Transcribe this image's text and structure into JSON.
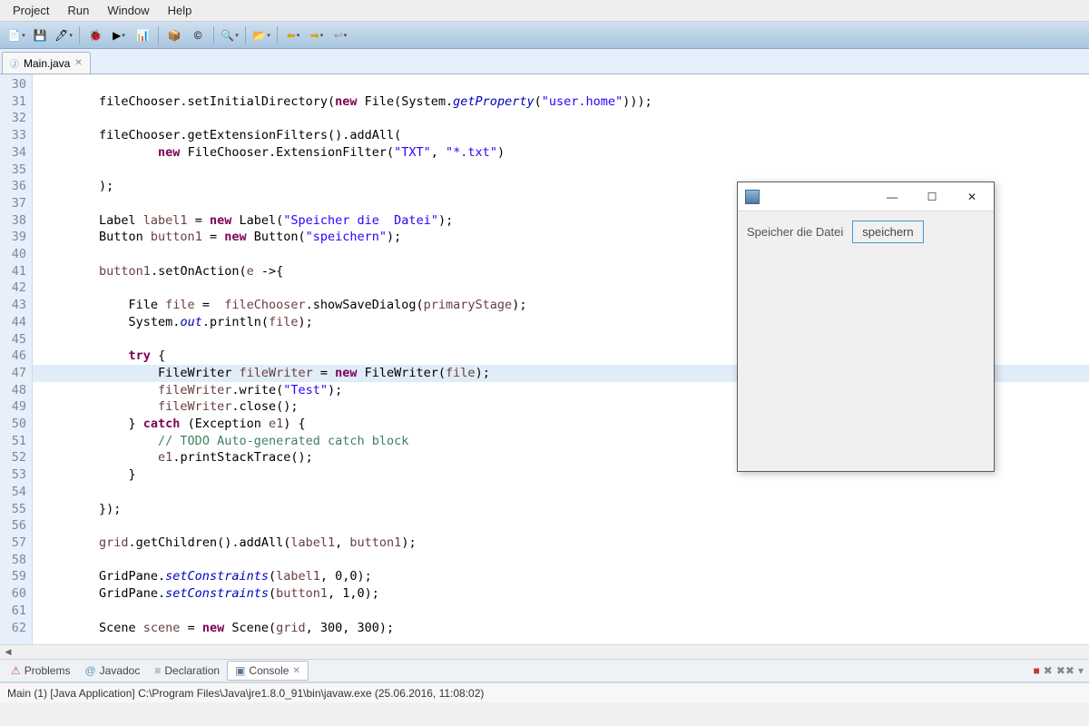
{
  "menu": {
    "items": [
      "Project",
      "Run",
      "Window",
      "Help"
    ]
  },
  "tab": {
    "name": "Main.java"
  },
  "gutter": {
    "start": 30,
    "end": 62
  },
  "highlight_line": 47,
  "code_lines": [
    {
      "n": 30,
      "tokens": []
    },
    {
      "n": 31,
      "tokens": [
        {
          "t": "        fileChooser.setInitialDirectory("
        },
        {
          "t": "new ",
          "c": "kw"
        },
        {
          "t": "File(System."
        },
        {
          "t": "getProperty",
          "c": "fstat"
        },
        {
          "t": "("
        },
        {
          "t": "\"user.home\"",
          "c": "str"
        },
        {
          "t": ")));"
        }
      ]
    },
    {
      "n": 32,
      "tokens": []
    },
    {
      "n": 33,
      "tokens": [
        {
          "t": "        fileChooser.getExtensionFilters().addAll("
        }
      ]
    },
    {
      "n": 34,
      "tokens": [
        {
          "t": "                "
        },
        {
          "t": "new ",
          "c": "kw"
        },
        {
          "t": "FileChooser.ExtensionFilter("
        },
        {
          "t": "\"TXT\"",
          "c": "str"
        },
        {
          "t": ", "
        },
        {
          "t": "\"*.txt\"",
          "c": "str"
        },
        {
          "t": ")"
        }
      ]
    },
    {
      "n": 35,
      "tokens": []
    },
    {
      "n": 36,
      "tokens": [
        {
          "t": "        );"
        }
      ]
    },
    {
      "n": 37,
      "tokens": []
    },
    {
      "n": 38,
      "tokens": [
        {
          "t": "        Label "
        },
        {
          "t": "label1",
          "c": "lvar"
        },
        {
          "t": " = "
        },
        {
          "t": "new ",
          "c": "kw"
        },
        {
          "t": "Label("
        },
        {
          "t": "\"Speicher die  Datei\"",
          "c": "str"
        },
        {
          "t": ");"
        }
      ]
    },
    {
      "n": 39,
      "tokens": [
        {
          "t": "        Button "
        },
        {
          "t": "button1",
          "c": "lvar"
        },
        {
          "t": " = "
        },
        {
          "t": "new ",
          "c": "kw"
        },
        {
          "t": "Button("
        },
        {
          "t": "\"speichern\"",
          "c": "str"
        },
        {
          "t": ");"
        }
      ]
    },
    {
      "n": 40,
      "tokens": []
    },
    {
      "n": 41,
      "tokens": [
        {
          "t": "        "
        },
        {
          "t": "button1",
          "c": "lvar"
        },
        {
          "t": ".setOnAction("
        },
        {
          "t": "e",
          "c": "lvar"
        },
        {
          "t": " ->{"
        }
      ]
    },
    {
      "n": 42,
      "tokens": []
    },
    {
      "n": 43,
      "tokens": [
        {
          "t": "            File "
        },
        {
          "t": "file",
          "c": "lvar"
        },
        {
          "t": " =  "
        },
        {
          "t": "fileChooser",
          "c": "lvar"
        },
        {
          "t": ".showSaveDialog("
        },
        {
          "t": "primaryStage",
          "c": "lvar"
        },
        {
          "t": ");"
        }
      ]
    },
    {
      "n": 44,
      "tokens": [
        {
          "t": "            System."
        },
        {
          "t": "out",
          "c": "fstat"
        },
        {
          "t": ".println("
        },
        {
          "t": "file",
          "c": "lvar"
        },
        {
          "t": ");"
        }
      ]
    },
    {
      "n": 45,
      "tokens": []
    },
    {
      "n": 46,
      "tokens": [
        {
          "t": "            "
        },
        {
          "t": "try",
          "c": "kw"
        },
        {
          "t": " {"
        }
      ]
    },
    {
      "n": 47,
      "tokens": [
        {
          "t": "                FileWriter "
        },
        {
          "t": "fileWriter",
          "c": "lvar"
        },
        {
          "t": " = "
        },
        {
          "t": "new ",
          "c": "kw"
        },
        {
          "t": "FileWriter("
        },
        {
          "t": "file",
          "c": "lvar"
        },
        {
          "t": ");"
        }
      ]
    },
    {
      "n": 48,
      "tokens": [
        {
          "t": "                "
        },
        {
          "t": "fileWriter",
          "c": "lvar"
        },
        {
          "t": ".write("
        },
        {
          "t": "\"Test\"",
          "c": "str"
        },
        {
          "t": ");"
        }
      ]
    },
    {
      "n": 49,
      "tokens": [
        {
          "t": "                "
        },
        {
          "t": "fileWriter",
          "c": "lvar"
        },
        {
          "t": ".close();"
        }
      ]
    },
    {
      "n": 50,
      "tokens": [
        {
          "t": "            } "
        },
        {
          "t": "catch",
          "c": "kw"
        },
        {
          "t": " (Exception "
        },
        {
          "t": "e1",
          "c": "lvar"
        },
        {
          "t": ") {"
        }
      ]
    },
    {
      "n": 51,
      "tokens": [
        {
          "t": "                "
        },
        {
          "t": "// TODO Auto-generated catch block",
          "c": "cm"
        }
      ]
    },
    {
      "n": 52,
      "tokens": [
        {
          "t": "                "
        },
        {
          "t": "e1",
          "c": "lvar"
        },
        {
          "t": ".printStackTrace();"
        }
      ]
    },
    {
      "n": 53,
      "tokens": [
        {
          "t": "            } "
        }
      ]
    },
    {
      "n": 54,
      "tokens": []
    },
    {
      "n": 55,
      "tokens": [
        {
          "t": "        });"
        }
      ]
    },
    {
      "n": 56,
      "tokens": []
    },
    {
      "n": 57,
      "tokens": [
        {
          "t": "        "
        },
        {
          "t": "grid",
          "c": "lvar"
        },
        {
          "t": ".getChildren().addAll("
        },
        {
          "t": "label1",
          "c": "lvar"
        },
        {
          "t": ", "
        },
        {
          "t": "button1",
          "c": "lvar"
        },
        {
          "t": ");"
        }
      ]
    },
    {
      "n": 58,
      "tokens": []
    },
    {
      "n": 59,
      "tokens": [
        {
          "t": "        GridPane."
        },
        {
          "t": "setConstraints",
          "c": "fstat"
        },
        {
          "t": "("
        },
        {
          "t": "label1",
          "c": "lvar"
        },
        {
          "t": ", 0,0);"
        }
      ]
    },
    {
      "n": 60,
      "tokens": [
        {
          "t": "        GridPane."
        },
        {
          "t": "setConstraints",
          "c": "fstat"
        },
        {
          "t": "("
        },
        {
          "t": "button1",
          "c": "lvar"
        },
        {
          "t": ", 1,0);"
        }
      ]
    },
    {
      "n": 61,
      "tokens": []
    },
    {
      "n": 62,
      "tokens": [
        {
          "t": "        Scene "
        },
        {
          "t": "scene",
          "c": "lvar"
        },
        {
          "t": " = "
        },
        {
          "t": "new ",
          "c": "kw"
        },
        {
          "t": "Scene("
        },
        {
          "t": "grid",
          "c": "lvar"
        },
        {
          "t": ", 300, 300);"
        }
      ]
    }
  ],
  "bottom_tabs": {
    "items": [
      {
        "label": "Problems",
        "active": false
      },
      {
        "label": "Javadoc",
        "active": false
      },
      {
        "label": "Declaration",
        "active": false
      },
      {
        "label": "Console",
        "active": true
      }
    ]
  },
  "status": {
    "text": "Main (1) [Java Application] C:\\Program Files\\Java\\jre1.8.0_91\\bin\\javaw.exe (25.06.2016, 11:08:02)"
  },
  "app_window": {
    "label_text": "Speicher die  Datei",
    "button_text": "speichern"
  }
}
